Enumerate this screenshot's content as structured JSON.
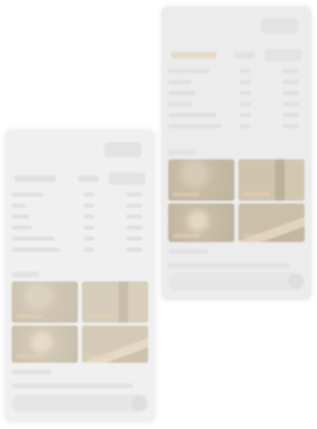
{
  "colors": {
    "page_bg": "#ffffff",
    "card_bg": "#ececec",
    "photo_warm": "#cbbfa8",
    "photo_dark": "#b9ad98"
  },
  "icons": {
    "send": "send-icon"
  },
  "screens": [
    {
      "title": "",
      "header_button": "",
      "tabs": [
        "",
        "",
        ""
      ],
      "rows": [
        [
          "",
          "",
          ""
        ],
        [
          "",
          "",
          ""
        ],
        [
          "",
          "",
          ""
        ],
        [
          "",
          "",
          ""
        ],
        [
          "",
          "",
          ""
        ],
        [
          "",
          "",
          ""
        ]
      ],
      "gallery_label": "",
      "photo_captions": [
        "",
        "",
        "",
        ""
      ],
      "caption_lines": [
        "",
        ""
      ],
      "composer_placeholder": ""
    },
    {
      "title": "",
      "header_button": "",
      "tabs": [
        "",
        "",
        ""
      ],
      "rows": [
        [
          "",
          "",
          ""
        ],
        [
          "",
          "",
          ""
        ],
        [
          "",
          "",
          ""
        ],
        [
          "",
          "",
          ""
        ],
        [
          "",
          "",
          ""
        ],
        [
          "",
          "",
          ""
        ]
      ],
      "gallery_label": "",
      "photo_captions": [
        "",
        "",
        "",
        ""
      ],
      "caption_lines": [
        "",
        ""
      ],
      "composer_placeholder": ""
    }
  ]
}
